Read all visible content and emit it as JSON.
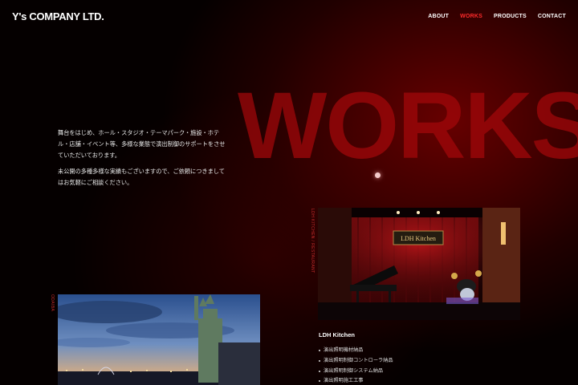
{
  "header": {
    "logo": "Y's COMPANY LTD.",
    "nav": [
      "ABOUT",
      "WORKS",
      "PRODUCTS",
      "CONTACT"
    ],
    "active_nav": "WORKS"
  },
  "hero": {
    "title": "WORKS",
    "intro": [
      "舞台をはじめ、ホール・スタジオ・テーマパーク・施設・ホテル・店舗・イベント等、多様な業態で演出制御のサポートをさせていただいております。",
      "未公開の多種多様な実績もございますので、ご依頼につきましてはお気軽にご相談ください。"
    ]
  },
  "cases": [
    {
      "vertical_label": "LDH KITCHEN / RESTAURANT",
      "photo": "ldh-kitchen-stage-photo",
      "title": "LDH Kitchen",
      "items": [
        "演出照明機材納品",
        "演出照明制御コントローラ納品",
        "演出照明制御システム納品",
        "演出照明施工工事"
      ]
    },
    {
      "vertical_label": "ODAIBA",
      "photo": "odaiba-statue-of-liberty-photo"
    }
  ],
  "colors": {
    "accent": "#ff2a2a",
    "hero_word": "#a4080a",
    "background": "#050000"
  }
}
